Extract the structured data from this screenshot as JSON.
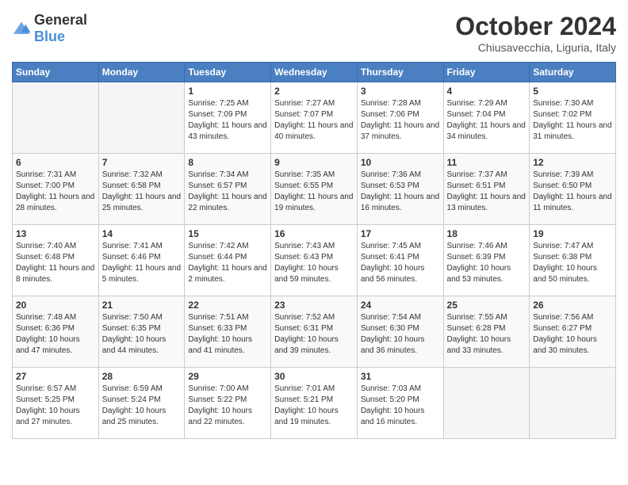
{
  "header": {
    "logo_general": "General",
    "logo_blue": "Blue",
    "month": "October 2024",
    "location": "Chiusavecchia, Liguria, Italy"
  },
  "days_of_week": [
    "Sunday",
    "Monday",
    "Tuesday",
    "Wednesday",
    "Thursday",
    "Friday",
    "Saturday"
  ],
  "weeks": [
    [
      {
        "day": "",
        "empty": true
      },
      {
        "day": "",
        "empty": true
      },
      {
        "day": "1",
        "sunrise": "Sunrise: 7:25 AM",
        "sunset": "Sunset: 7:09 PM",
        "daylight": "Daylight: 11 hours and 43 minutes."
      },
      {
        "day": "2",
        "sunrise": "Sunrise: 7:27 AM",
        "sunset": "Sunset: 7:07 PM",
        "daylight": "Daylight: 11 hours and 40 minutes."
      },
      {
        "day": "3",
        "sunrise": "Sunrise: 7:28 AM",
        "sunset": "Sunset: 7:06 PM",
        "daylight": "Daylight: 11 hours and 37 minutes."
      },
      {
        "day": "4",
        "sunrise": "Sunrise: 7:29 AM",
        "sunset": "Sunset: 7:04 PM",
        "daylight": "Daylight: 11 hours and 34 minutes."
      },
      {
        "day": "5",
        "sunrise": "Sunrise: 7:30 AM",
        "sunset": "Sunset: 7:02 PM",
        "daylight": "Daylight: 11 hours and 31 minutes."
      }
    ],
    [
      {
        "day": "6",
        "sunrise": "Sunrise: 7:31 AM",
        "sunset": "Sunset: 7:00 PM",
        "daylight": "Daylight: 11 hours and 28 minutes."
      },
      {
        "day": "7",
        "sunrise": "Sunrise: 7:32 AM",
        "sunset": "Sunset: 6:58 PM",
        "daylight": "Daylight: 11 hours and 25 minutes."
      },
      {
        "day": "8",
        "sunrise": "Sunrise: 7:34 AM",
        "sunset": "Sunset: 6:57 PM",
        "daylight": "Daylight: 11 hours and 22 minutes."
      },
      {
        "day": "9",
        "sunrise": "Sunrise: 7:35 AM",
        "sunset": "Sunset: 6:55 PM",
        "daylight": "Daylight: 11 hours and 19 minutes."
      },
      {
        "day": "10",
        "sunrise": "Sunrise: 7:36 AM",
        "sunset": "Sunset: 6:53 PM",
        "daylight": "Daylight: 11 hours and 16 minutes."
      },
      {
        "day": "11",
        "sunrise": "Sunrise: 7:37 AM",
        "sunset": "Sunset: 6:51 PM",
        "daylight": "Daylight: 11 hours and 13 minutes."
      },
      {
        "day": "12",
        "sunrise": "Sunrise: 7:39 AM",
        "sunset": "Sunset: 6:50 PM",
        "daylight": "Daylight: 11 hours and 11 minutes."
      }
    ],
    [
      {
        "day": "13",
        "sunrise": "Sunrise: 7:40 AM",
        "sunset": "Sunset: 6:48 PM",
        "daylight": "Daylight: 11 hours and 8 minutes."
      },
      {
        "day": "14",
        "sunrise": "Sunrise: 7:41 AM",
        "sunset": "Sunset: 6:46 PM",
        "daylight": "Daylight: 11 hours and 5 minutes."
      },
      {
        "day": "15",
        "sunrise": "Sunrise: 7:42 AM",
        "sunset": "Sunset: 6:44 PM",
        "daylight": "Daylight: 11 hours and 2 minutes."
      },
      {
        "day": "16",
        "sunrise": "Sunrise: 7:43 AM",
        "sunset": "Sunset: 6:43 PM",
        "daylight": "Daylight: 10 hours and 59 minutes."
      },
      {
        "day": "17",
        "sunrise": "Sunrise: 7:45 AM",
        "sunset": "Sunset: 6:41 PM",
        "daylight": "Daylight: 10 hours and 56 minutes."
      },
      {
        "day": "18",
        "sunrise": "Sunrise: 7:46 AM",
        "sunset": "Sunset: 6:39 PM",
        "daylight": "Daylight: 10 hours and 53 minutes."
      },
      {
        "day": "19",
        "sunrise": "Sunrise: 7:47 AM",
        "sunset": "Sunset: 6:38 PM",
        "daylight": "Daylight: 10 hours and 50 minutes."
      }
    ],
    [
      {
        "day": "20",
        "sunrise": "Sunrise: 7:48 AM",
        "sunset": "Sunset: 6:36 PM",
        "daylight": "Daylight: 10 hours and 47 minutes."
      },
      {
        "day": "21",
        "sunrise": "Sunrise: 7:50 AM",
        "sunset": "Sunset: 6:35 PM",
        "daylight": "Daylight: 10 hours and 44 minutes."
      },
      {
        "day": "22",
        "sunrise": "Sunrise: 7:51 AM",
        "sunset": "Sunset: 6:33 PM",
        "daylight": "Daylight: 10 hours and 41 minutes."
      },
      {
        "day": "23",
        "sunrise": "Sunrise: 7:52 AM",
        "sunset": "Sunset: 6:31 PM",
        "daylight": "Daylight: 10 hours and 39 minutes."
      },
      {
        "day": "24",
        "sunrise": "Sunrise: 7:54 AM",
        "sunset": "Sunset: 6:30 PM",
        "daylight": "Daylight: 10 hours and 36 minutes."
      },
      {
        "day": "25",
        "sunrise": "Sunrise: 7:55 AM",
        "sunset": "Sunset: 6:28 PM",
        "daylight": "Daylight: 10 hours and 33 minutes."
      },
      {
        "day": "26",
        "sunrise": "Sunrise: 7:56 AM",
        "sunset": "Sunset: 6:27 PM",
        "daylight": "Daylight: 10 hours and 30 minutes."
      }
    ],
    [
      {
        "day": "27",
        "sunrise": "Sunrise: 6:57 AM",
        "sunset": "Sunset: 5:25 PM",
        "daylight": "Daylight: 10 hours and 27 minutes."
      },
      {
        "day": "28",
        "sunrise": "Sunrise: 6:59 AM",
        "sunset": "Sunset: 5:24 PM",
        "daylight": "Daylight: 10 hours and 25 minutes."
      },
      {
        "day": "29",
        "sunrise": "Sunrise: 7:00 AM",
        "sunset": "Sunset: 5:22 PM",
        "daylight": "Daylight: 10 hours and 22 minutes."
      },
      {
        "day": "30",
        "sunrise": "Sunrise: 7:01 AM",
        "sunset": "Sunset: 5:21 PM",
        "daylight": "Daylight: 10 hours and 19 minutes."
      },
      {
        "day": "31",
        "sunrise": "Sunrise: 7:03 AM",
        "sunset": "Sunset: 5:20 PM",
        "daylight": "Daylight: 10 hours and 16 minutes."
      },
      {
        "day": "",
        "empty": true
      },
      {
        "day": "",
        "empty": true
      }
    ]
  ]
}
